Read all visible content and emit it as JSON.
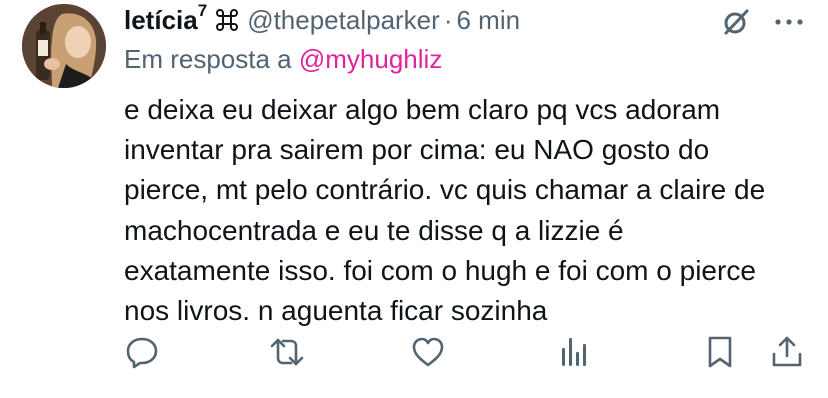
{
  "author": {
    "name": "letícia",
    "name_sup": "7",
    "badge_icon": "cross-knot-icon",
    "handle": "@thepetalparker",
    "separator": "·",
    "time": "6 min"
  },
  "reply": {
    "prefix": "Em resposta a",
    "mention": "@myhughliz"
  },
  "body_lines": [
    "e deixa eu deixar algo bem claro pq vcs adoram",
    "inventar pra sairem por cima: eu NAO gosto do",
    "pierce, mt pelo contrário. vc quis chamar a claire de",
    "machocentrada e eu te disse q a lizzie é",
    "exatamente isso. foi com o hugh e foi com o pierce",
    "nos livros. n aguenta ficar sozinha"
  ],
  "actions": {
    "reply": "reply-icon",
    "retweet": "retweet-icon",
    "like": "heart-icon",
    "views": "analytics-icon",
    "bookmark": "bookmark-icon",
    "share": "share-icon"
  },
  "colors": {
    "text": "#0f1419",
    "muted": "#536471",
    "mention": "#e0249c"
  }
}
